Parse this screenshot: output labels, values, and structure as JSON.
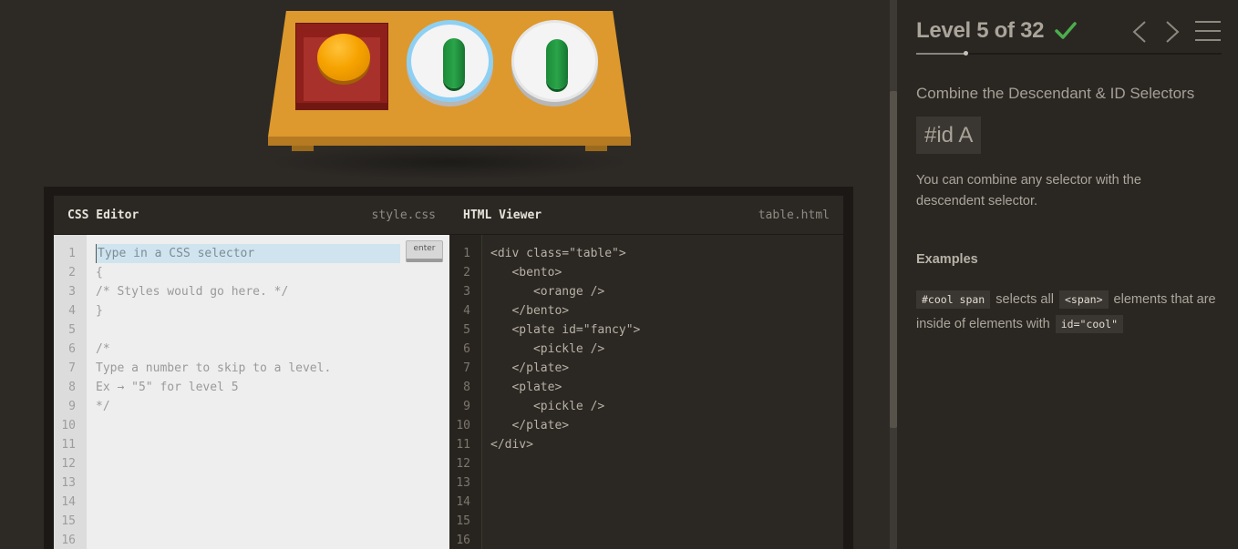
{
  "editor": {
    "css_title": "CSS Editor",
    "css_file": "style.css",
    "html_title": "HTML Viewer",
    "html_file": "table.html",
    "input_placeholder": "Type in a CSS selector",
    "enter_label": "enter",
    "line_numbers": [
      "1",
      "2",
      "3",
      "4",
      "5",
      "6",
      "7",
      "8",
      "9",
      "10",
      "11",
      "12",
      "13",
      "14",
      "15",
      "16"
    ],
    "css_lines": "{\n/* Styles would go here. */\n}\n\n/*\nType a number to skip to a level.\nEx → \"5\" for level 5\n*/",
    "html_lines": "<div class=\"table\">\n   <bento>\n      <orange />\n   </bento>\n   <plate id=\"fancy\">\n      <pickle />\n   </plate>\n   <plate>\n      <pickle />\n   </plate>\n</div>"
  },
  "sidebar": {
    "level_title": "Level 5 of 32",
    "level_progress": 0.16,
    "selector_name": "Combine the Descendant & ID Selectors",
    "syntax": "#id  A",
    "hint": "You can combine any selector with the descendent selector.",
    "examples_title": "Examples",
    "example": {
      "code1": "#cool span",
      "text1": " selects all ",
      "code2": "<span>",
      "text2": " elements that are inside of elements with ",
      "code3": "id=\"cool\""
    }
  },
  "colors": {
    "background": "#2d2a26",
    "table": "#dd992d",
    "bento": "#8f1f1a",
    "orange": "#f6a300",
    "pickle": "#2aa54a",
    "fancy_rim": "#8ed0f4",
    "check": "#4cae4c"
  },
  "icons": {
    "check": "check-icon",
    "prev": "chevron-left-icon",
    "next": "chevron-right-icon",
    "menu": "hamburger-menu-icon"
  }
}
